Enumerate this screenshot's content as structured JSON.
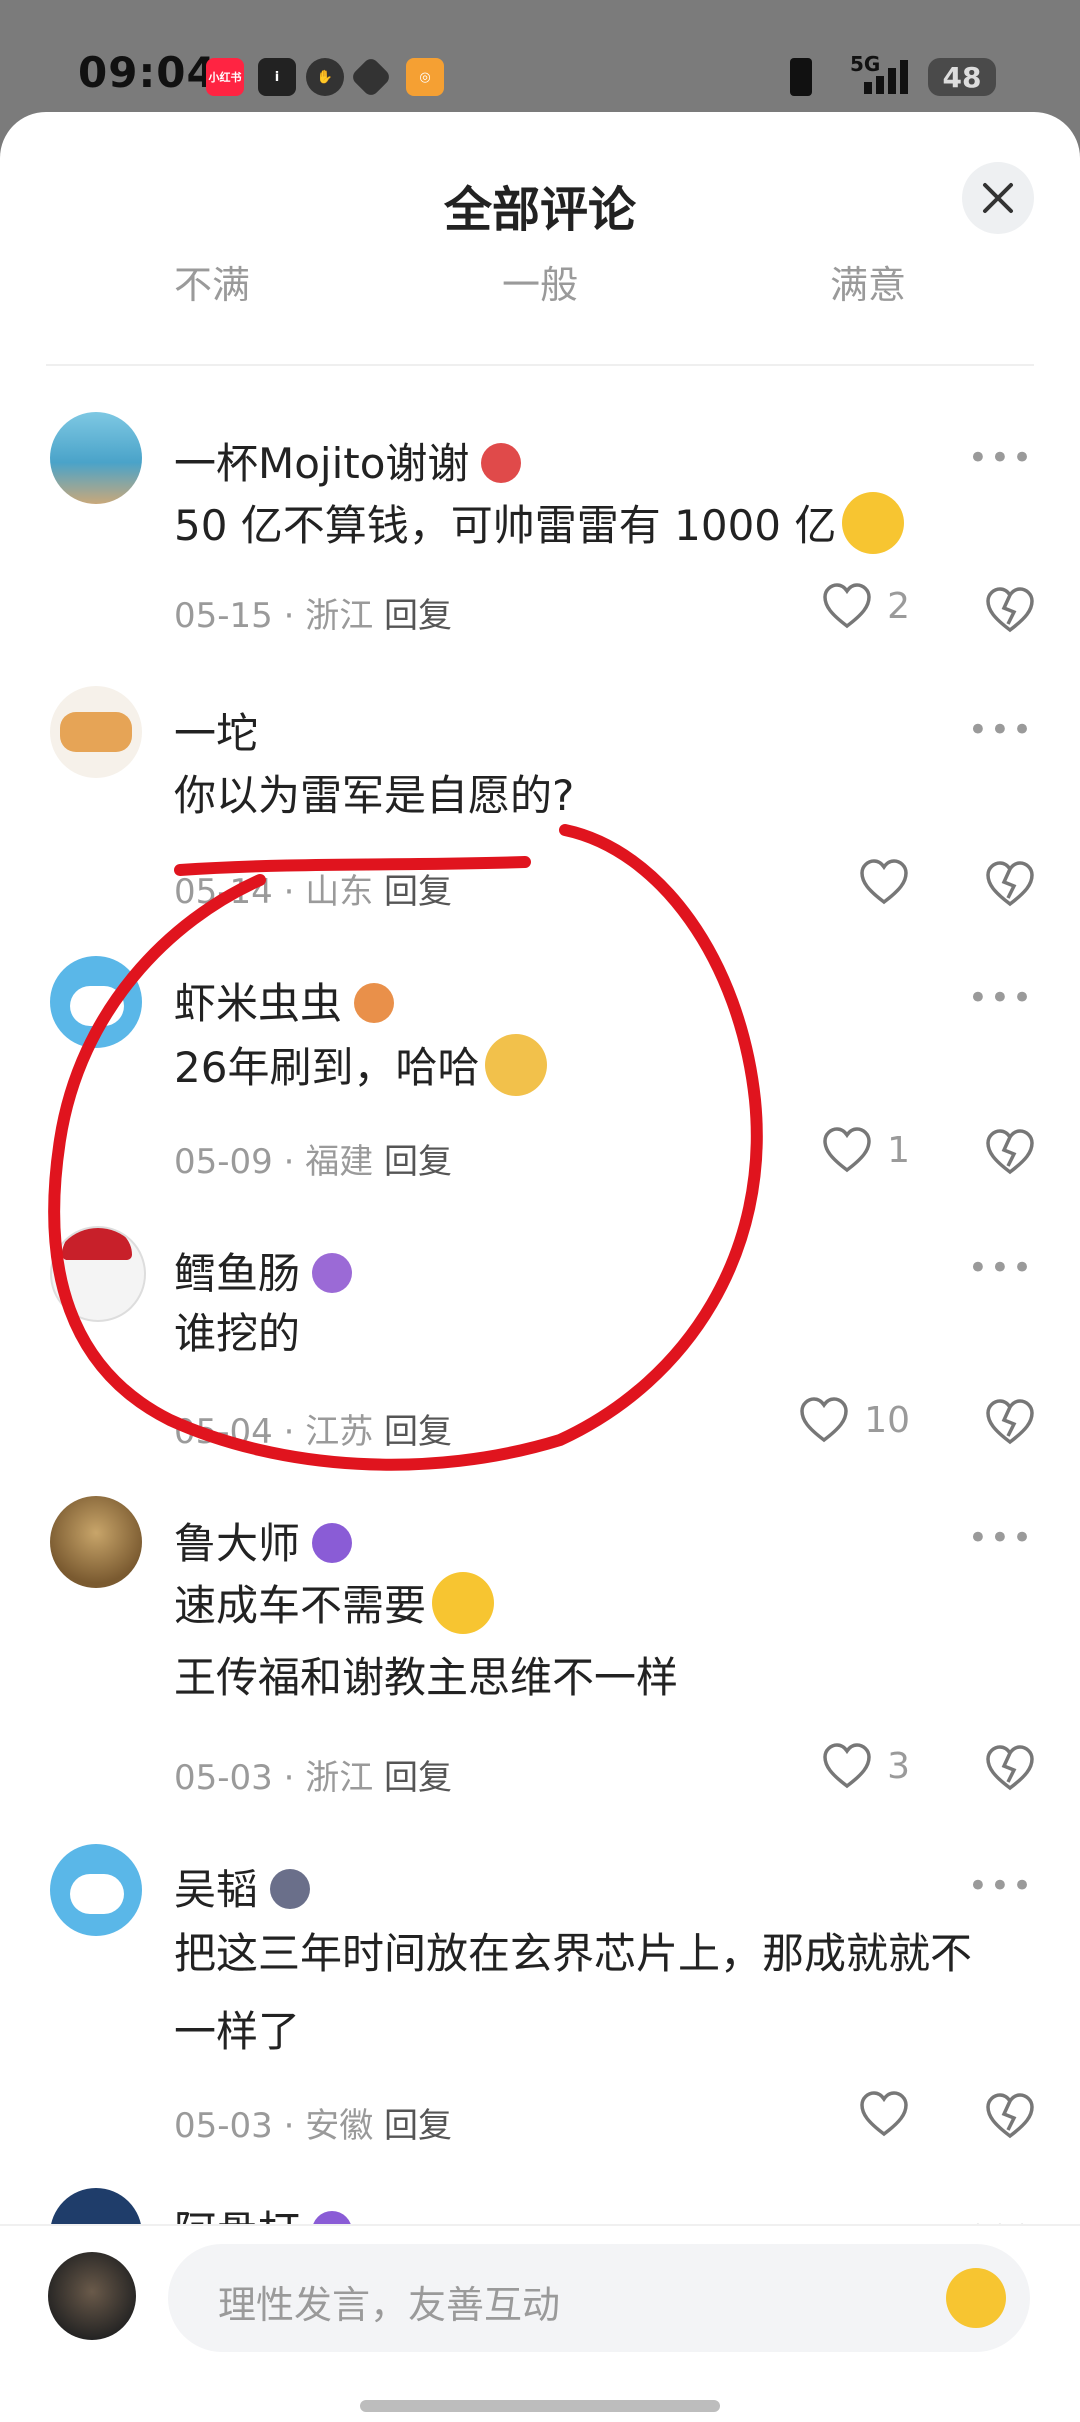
{
  "status_bar": {
    "time": "09:04",
    "app_icons": [
      "xiaohongshu-icon",
      "info-icon",
      "hand-icon",
      "grid-icon",
      "search-app-icon"
    ],
    "xhs_label": "小红书",
    "network": "5G",
    "battery": "48"
  },
  "header": {
    "title": "全部评论",
    "filters": [
      "不满",
      "一般",
      "满意"
    ]
  },
  "comments": [
    {
      "username": "一杯Mojito谢谢",
      "badge_color": "#e04a4a",
      "text": "50 亿不算钱，可帅雷雷有 1000 亿",
      "emoji": "thinking-face",
      "date": "05-15",
      "location": "浙江",
      "reply": "回复",
      "likes": "2"
    },
    {
      "username": "一坨",
      "badge_color": "",
      "text": "你以为雷军是自愿的?",
      "emoji": "",
      "date": "05-14",
      "location": "山东",
      "reply": "回复",
      "likes": ""
    },
    {
      "username": "虾米虫虫",
      "badge_color": "#e9904a",
      "text": "26年刷到，哈哈",
      "emoji": "dog-face",
      "date": "05-09",
      "location": "福建",
      "reply": "回复",
      "likes": "1"
    },
    {
      "username": "鳕鱼肠",
      "badge_color": "#9b6ad6",
      "text": "谁挖的",
      "emoji": "",
      "date": "05-04",
      "location": "江苏",
      "reply": "回复",
      "likes": "10"
    },
    {
      "username": "鲁大师",
      "badge_color": "#8a5cd6",
      "text": "速成车不需要",
      "text2": "王传福和谢教主思维不一样",
      "emoji": "grinning-face",
      "date": "05-03",
      "location": "浙江",
      "reply": "回复",
      "likes": "3"
    },
    {
      "username": "吴韬",
      "badge_color": "#6a6f8a",
      "text": "把这三年时间放在玄界芯片上，那成就就不",
      "text2": "一样了",
      "emoji": "",
      "date": "05-03",
      "location": "安徽",
      "reply": "回复",
      "likes": ""
    },
    {
      "username": "阿骨打",
      "badge_color": "#8a5cd6",
      "text": "",
      "emoji": "",
      "date": "",
      "location": "",
      "reply": "",
      "likes": ""
    }
  ],
  "input": {
    "placeholder": "理性发言，友善互动"
  },
  "colors": {
    "annotation_red": "#e0141e",
    "muted": "#9a9a9a"
  }
}
